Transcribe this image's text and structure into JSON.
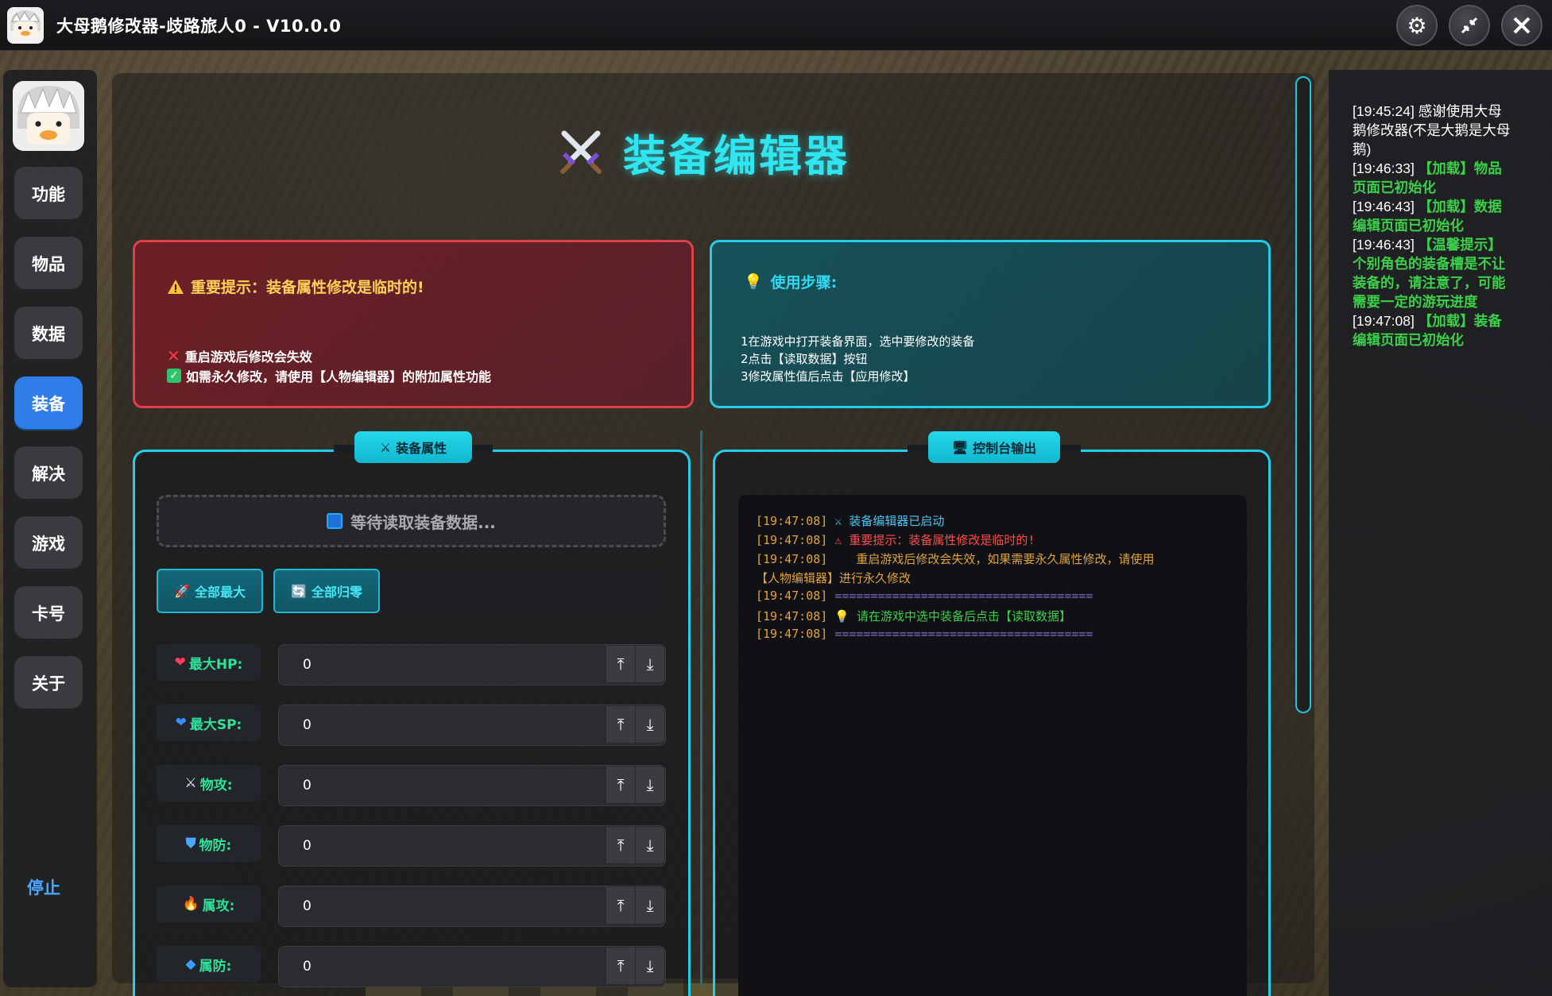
{
  "window": {
    "title": "大母鹅修改器-歧路旅人0 - V10.0.0",
    "buttons": [
      "gear-icon",
      "collapse-icon",
      "close-icon"
    ]
  },
  "sidebar": {
    "items": [
      {
        "label": "功能",
        "active": false
      },
      {
        "label": "物品",
        "active": false
      },
      {
        "label": "数据",
        "active": false
      },
      {
        "label": "装备",
        "active": true
      },
      {
        "label": "解决",
        "active": false
      },
      {
        "label": "游戏",
        "active": false
      },
      {
        "label": "卡号",
        "active": false
      },
      {
        "label": "关于",
        "active": false
      }
    ],
    "stop_label": "停止"
  },
  "page": {
    "title": "装备编辑器"
  },
  "notice_warning": {
    "heading": "重要提示：装备属性修改是临时的!",
    "line1": "重启游戏后修改会失效",
    "line2": "如需永久修改，请使用【人物编辑器】的附加属性功能"
  },
  "notice_steps": {
    "heading": "使用步骤:",
    "steps": [
      "1在游戏中打开装备界面，选中要修改的装备",
      "2点击【读取数据】按钮",
      "3修改属性值后点击【应用修改】"
    ]
  },
  "equip_panel": {
    "tab_label": "装备属性",
    "waiting_text": "等待读取装备数据...",
    "btn_max": "全部最大",
    "btn_zero": "全部归零",
    "attributes": [
      {
        "label": "最大HP:",
        "icon": "heart-icon",
        "value": "0"
      },
      {
        "label": "最大SP:",
        "icon": "blue-heart-icon",
        "value": "0"
      },
      {
        "label": "物攻:",
        "icon": "swords-icon",
        "value": "0"
      },
      {
        "label": "物防:",
        "icon": "shield-icon",
        "value": "0"
      },
      {
        "label": "属攻:",
        "icon": "fire-icon",
        "value": "0"
      },
      {
        "label": "属防:",
        "icon": "cube-icon",
        "value": "0"
      }
    ]
  },
  "console_panel": {
    "tab_label": "控制台输出",
    "lines": [
      {
        "ts": "[19:47:08]",
        "text": "⚔ 装备编辑器已启动",
        "color": "#4fc3f0"
      },
      {
        "ts": "[19:47:08]",
        "text": "⚠ 重要提示：装备属性修改是临时的!",
        "color": "#ff4b4b"
      },
      {
        "ts": "[19:47:08]",
        "text": "   重启游戏后修改会失效，如果需要永久属性修改，请使用",
        "color": "#e3a23a"
      },
      {
        "ts": "",
        "text": "【人物编辑器】进行永久修改",
        "color": "#e3a23a"
      },
      {
        "ts": "[19:47:08]",
        "text": "====================================",
        "color": "#8a6fd0"
      },
      {
        "ts": "[19:47:08]",
        "text": "💡 请在游戏中选中装备后点击【读取数据】",
        "color": "#3ccf4a"
      },
      {
        "ts": "[19:47:08]",
        "text": "====================================",
        "color": "#8a6fd0"
      }
    ]
  },
  "log_panel": {
    "entries": [
      {
        "ts": "[19:45:24]",
        "text": "感谢使用大母鹅修改器(不是大鹅是大母鹅)",
        "green": false
      },
      {
        "ts": "[19:46:33]",
        "text": "【加载】物品页面已初始化",
        "green": true
      },
      {
        "ts": "[19:46:43]",
        "text": "【加载】数据编辑页面已初始化",
        "green": true
      },
      {
        "ts": "[19:46:43]",
        "text": "【温馨提示】个别角色的装备槽是不让装备的，请注意了，可能需要一定的游玩进度",
        "green": true
      },
      {
        "ts": "[19:47:08]",
        "text": "【加载】装备编辑页面已初始化",
        "green": true
      }
    ]
  },
  "colors": {
    "accent_cyan": "#22cfe8",
    "active_nav": "#2f7de8",
    "warning_border": "#e0404a",
    "log_green": "#3ccf4a"
  }
}
